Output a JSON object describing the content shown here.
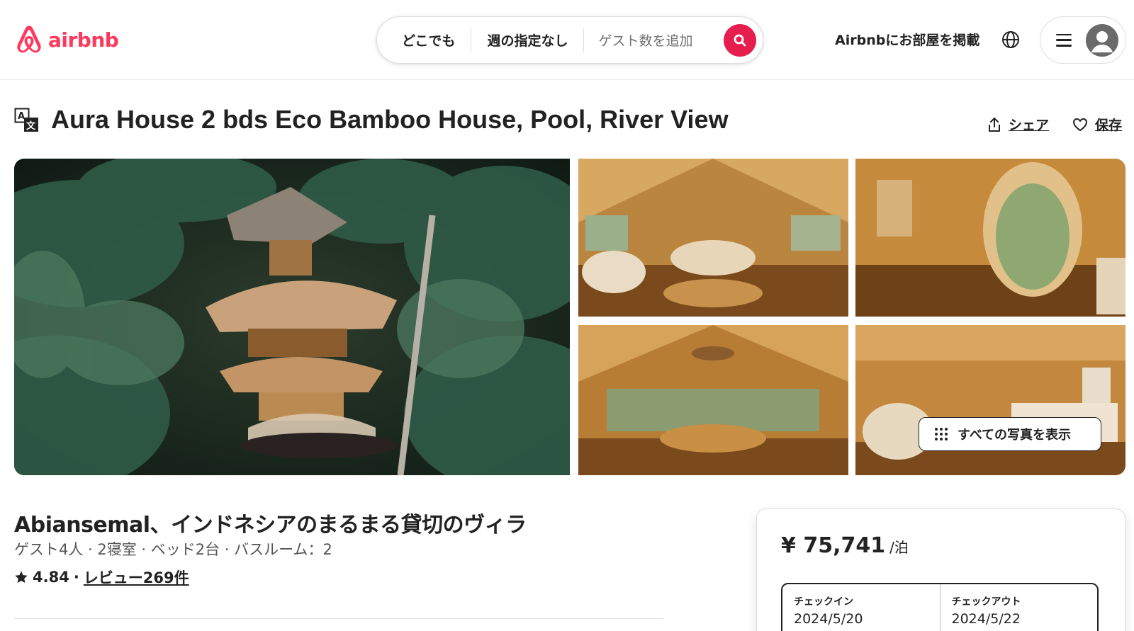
{
  "header": {
    "logo_text": "airbnb",
    "search": {
      "where": "どこでも",
      "when": "週の指定なし",
      "guests_placeholder": "ゲスト数を追加"
    },
    "host_link": "Airbnbにお部屋を掲載",
    "icons": [
      "airbnb-logo-icon",
      "search-icon",
      "globe-icon",
      "menu-icon",
      "user-avatar-icon"
    ]
  },
  "listing": {
    "title": "Aura House 2 bds Eco Bamboo House, Pool, River View",
    "share_label": "シェア",
    "save_label": "保存",
    "show_all_photos": "すべての写真を表示",
    "subtitle": "Abiansemal、インドネシアのまるまる貸切のヴィラ",
    "specs": "ゲスト4人 · 2寝室 · ベッド2台 · バスルーム：2",
    "rating": "4.84",
    "rating_separator": "·",
    "reviews": "レビュー269件"
  },
  "booking": {
    "price": "¥ 75,741",
    "per_night": "/泊",
    "checkin_label": "チェックイン",
    "checkin_value": "2024/5/20",
    "checkout_label": "チェックアウト",
    "checkout_value": "2024/5/22"
  },
  "colors": {
    "brand": "#ff385c",
    "search_button": "#e61e4d",
    "text": "#222222",
    "muted": "#717171"
  }
}
